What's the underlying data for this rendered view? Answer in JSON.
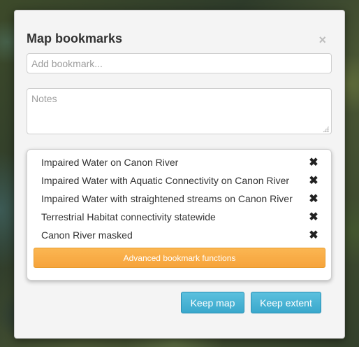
{
  "dialog": {
    "title": "Map bookmarks",
    "close_glyph": "×",
    "add_input": {
      "value": "",
      "placeholder": "Add bookmark..."
    },
    "notes_input": {
      "value": "",
      "placeholder": "Notes"
    }
  },
  "bookmarks": {
    "items": [
      {
        "label": "Impaired Water on Canon River",
        "remove_glyph": "✖"
      },
      {
        "label": "Impaired Water with Aquatic Connectivity on Canon River",
        "remove_glyph": "✖"
      },
      {
        "label": "Impaired Water with straightened streams on Canon River",
        "remove_glyph": "✖"
      },
      {
        "label": "Terrestrial Habitat connectivity statewide",
        "remove_glyph": "✖"
      },
      {
        "label": "Canon River masked",
        "remove_glyph": "✖"
      }
    ],
    "advanced_label": "Advanced bookmark functions"
  },
  "footer": {
    "keep_map_label": "Keep map",
    "keep_extent_label": "Keep extent"
  },
  "colors": {
    "primary_button": "#5bc0de",
    "warning_button": "#f6a33b",
    "dialog_bg": "#f4f4f4"
  },
  "icons": {
    "close": "close-icon",
    "remove": "remove-icon",
    "resize_grip": "resize-grip-icon"
  }
}
